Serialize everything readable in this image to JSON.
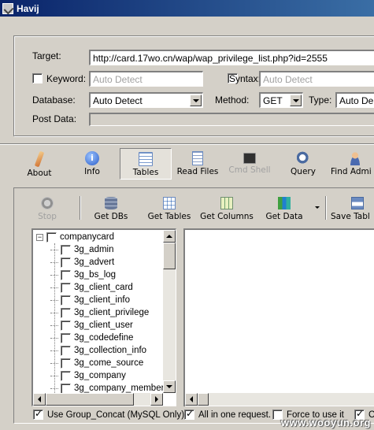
{
  "window": {
    "title": "Havij",
    "icon": "havij-app-icon"
  },
  "target_group": {
    "target_label": "Target:",
    "target_value": "http://card.17wo.cn/wap/wap_privilege_list.php?id=2555",
    "keyword_label": "Keyword:",
    "keyword_checked": false,
    "keyword_placeholder": "Auto Detect",
    "syntax_label": "Syntax:",
    "syntax_checked": false,
    "syntax_placeholder": "Auto Detect",
    "database_label": "Database:",
    "database_value": "Auto Detect",
    "method_label": "Method:",
    "method_value": "GET",
    "type_label": "Type:",
    "type_value": "Auto De",
    "post_data_label": "Post Data:",
    "post_data_value": ""
  },
  "main_toolbar": [
    {
      "label": "About",
      "icon": "wand-icon",
      "color": "#e0a060"
    },
    {
      "label": "Info",
      "icon": "info-icon",
      "color": "#3a6fd8"
    },
    {
      "label": "Tables",
      "icon": "tables-icon",
      "color": "#8ab0e0",
      "active": true
    },
    {
      "label": "Read Files",
      "icon": "file-icon",
      "color": "#6a8ac8"
    },
    {
      "label": "Cmd Shell",
      "icon": "terminal-icon",
      "color": "#404040",
      "disabled": true
    },
    {
      "label": "Query",
      "icon": "query-icon",
      "color": "#5a7ab0"
    },
    {
      "label": "Find Admi",
      "icon": "users-icon",
      "color": "#4a6aa0"
    }
  ],
  "tables_toolbar": [
    {
      "label": "Stop",
      "icon": "stop-icon",
      "disabled": true
    },
    {
      "label": "Get DBs",
      "icon": "database-icon"
    },
    {
      "label": "Get Tables",
      "icon": "table-icon"
    },
    {
      "label": "Get Columns",
      "icon": "columns-icon"
    },
    {
      "label": "Get Data",
      "icon": "data-icon"
    },
    {
      "label": "Save Tabl",
      "icon": "save-icon"
    }
  ],
  "tree": {
    "root": {
      "label": "companycard",
      "checked": false,
      "expanded": true
    },
    "items": [
      "3g_admin",
      "3g_advert",
      "3g_bs_log",
      "3g_client_card",
      "3g_client_info",
      "3g_client_privilege",
      "3g_client_user",
      "3g_codedefine",
      "3g_collection_info",
      "3g_come_source",
      "3g_company",
      "3g_company_member"
    ]
  },
  "options": {
    "group_concat_label": "Use Group_Concat (MySQL Only)",
    "group_concat_checked": true,
    "all_in_one_label": "All in one request.",
    "all_in_one_checked": true,
    "force_label": "Force to use it",
    "force_checked": false,
    "extra_label": "C",
    "extra_checked": true
  },
  "watermark": "www.wooyun.org"
}
